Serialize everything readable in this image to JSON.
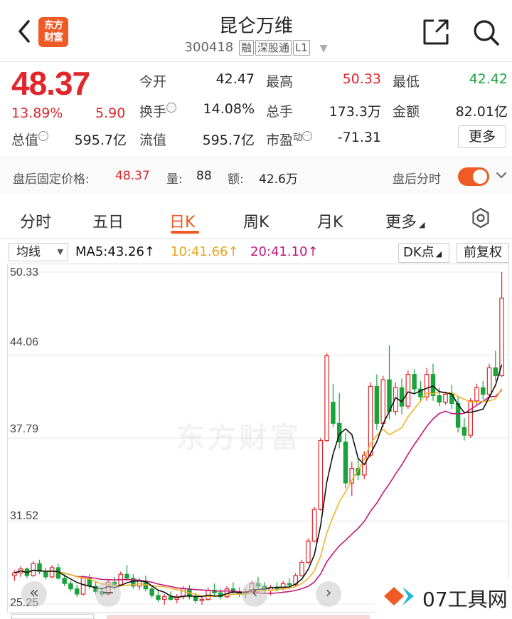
{
  "header": {
    "logo_text_1": "东方",
    "logo_text_2": "财富",
    "stock_name": "昆仑万维",
    "stock_code": "300418",
    "tags": [
      "融",
      "深股通",
      "L1"
    ]
  },
  "quote": {
    "price": "48.37",
    "change_pct": "13.89%",
    "change": "5.90",
    "fields": {
      "open_label": "今开",
      "open": "42.47",
      "high_label": "最高",
      "high": "50.33",
      "low_label": "最低",
      "low": "42.42",
      "turnover_label": "换手",
      "turnover": "14.08%",
      "volume_label": "总手",
      "volume": "173.3万",
      "amount_label": "金额",
      "amount": "82.01亿",
      "mktcap_label": "总值",
      "mktcap": "595.7亿",
      "float_label": "流值",
      "float": "595.7亿",
      "pe_label": "市盈",
      "pe_sup": "动",
      "pe": "-71.31"
    },
    "more_label": "更多"
  },
  "after_hours": {
    "price_label": "盘后固定价格:",
    "price": "48.37",
    "vol_label": "量:",
    "vol": "88",
    "amt_label": "额:",
    "amt": "42.6万",
    "intraday_label": "盘后分时"
  },
  "tabs": [
    "分时",
    "五日",
    "日K",
    "周K",
    "月K",
    "更多"
  ],
  "active_tab": "日K",
  "indicators": {
    "avg_label": "均线",
    "ma5": "MA5:43.26",
    "ma10": "10:41.66",
    "ma20": "20:41.10",
    "dk_label": "DK点",
    "adjust_label": "前复权"
  },
  "colors": {
    "up": "#e0262b",
    "down": "#1aa33a",
    "accent": "#f05a24",
    "ma5": "#111111",
    "ma10": "#f0b429",
    "ma20": "#c2187a"
  },
  "chart_data": {
    "type": "candlestick",
    "yticks": [
      "50.33",
      "44.06",
      "37.79",
      "31.52",
      "25.25"
    ],
    "ylim": [
      25.25,
      50.33
    ],
    "candles": [
      [
        27.4,
        27.8,
        27.0,
        27.6
      ],
      [
        27.6,
        28.1,
        27.3,
        27.9
      ],
      [
        27.9,
        28.0,
        27.2,
        27.4
      ],
      [
        27.4,
        28.5,
        27.3,
        28.3
      ],
      [
        28.3,
        28.6,
        27.5,
        27.7
      ],
      [
        27.7,
        28.0,
        27.1,
        27.3
      ],
      [
        27.3,
        28.2,
        27.2,
        28.0
      ],
      [
        28.0,
        28.3,
        27.1,
        27.2
      ],
      [
        27.2,
        27.5,
        26.6,
        26.8
      ],
      [
        26.8,
        27.0,
        26.2,
        26.4
      ],
      [
        26.4,
        26.7,
        25.8,
        26.0
      ],
      [
        26.0,
        27.4,
        25.9,
        27.2
      ],
      [
        27.2,
        27.5,
        26.4,
        26.6
      ],
      [
        26.6,
        26.9,
        26.0,
        26.2
      ],
      [
        26.2,
        26.5,
        25.8,
        26.0
      ],
      [
        26.0,
        27.1,
        25.9,
        26.9
      ],
      [
        26.9,
        27.3,
        26.5,
        26.7
      ],
      [
        26.7,
        27.7,
        26.6,
        27.5
      ],
      [
        27.5,
        28.2,
        27.0,
        27.2
      ],
      [
        27.2,
        27.5,
        26.4,
        26.6
      ],
      [
        26.6,
        27.2,
        26.3,
        27.0
      ],
      [
        27.0,
        27.4,
        26.2,
        26.4
      ],
      [
        26.4,
        26.7,
        25.7,
        25.9
      ],
      [
        25.9,
        26.3,
        25.4,
        25.6
      ],
      [
        25.6,
        26.0,
        25.2,
        25.8
      ],
      [
        25.8,
        26.2,
        25.5,
        25.6
      ],
      [
        25.6,
        26.0,
        25.3,
        25.8
      ],
      [
        25.8,
        26.6,
        25.6,
        26.4
      ],
      [
        26.4,
        26.7,
        25.6,
        25.8
      ],
      [
        25.8,
        26.1,
        25.3,
        25.5
      ],
      [
        25.5,
        25.8,
        25.2,
        25.6
      ],
      [
        25.6,
        26.5,
        25.5,
        26.3
      ],
      [
        26.3,
        26.8,
        25.9,
        26.1
      ],
      [
        26.1,
        26.4,
        25.6,
        25.8
      ],
      [
        25.8,
        26.6,
        25.7,
        26.4
      ],
      [
        26.4,
        26.9,
        26.0,
        26.2
      ],
      [
        26.2,
        26.5,
        25.8,
        26.0
      ],
      [
        26.0,
        26.4,
        25.7,
        26.2
      ],
      [
        26.2,
        27.0,
        26.1,
        26.8
      ],
      [
        26.8,
        27.3,
        26.4,
        26.6
      ],
      [
        26.6,
        26.9,
        26.1,
        26.3
      ],
      [
        26.3,
        26.7,
        25.9,
        26.5
      ],
      [
        26.5,
        26.9,
        26.2,
        26.4
      ],
      [
        26.4,
        27.0,
        26.3,
        26.8
      ],
      [
        26.8,
        27.2,
        26.5,
        26.7
      ],
      [
        26.7,
        27.6,
        26.6,
        27.4
      ],
      [
        27.4,
        28.6,
        27.3,
        28.4
      ],
      [
        28.4,
        30.2,
        28.3,
        30.0
      ],
      [
        30.0,
        32.6,
        29.9,
        32.4
      ],
      [
        32.4,
        37.8,
        32.3,
        37.6
      ],
      [
        37.6,
        44.2,
        37.5,
        44.0
      ],
      [
        40.5,
        41.9,
        38.6,
        38.9
      ],
      [
        38.9,
        41.2,
        37.0,
        37.5
      ],
      [
        37.5,
        38.2,
        34.0,
        34.4
      ],
      [
        34.4,
        36.0,
        33.4,
        35.5
      ],
      [
        35.5,
        36.3,
        34.6,
        35.0
      ],
      [
        35.0,
        36.8,
        34.7,
        36.5
      ],
      [
        36.5,
        42.0,
        36.3,
        41.7
      ],
      [
        41.7,
        42.6,
        38.4,
        38.9
      ],
      [
        38.9,
        42.5,
        38.6,
        42.2
      ],
      [
        42.2,
        44.8,
        39.2,
        39.8
      ],
      [
        39.8,
        42.0,
        39.5,
        41.6
      ],
      [
        41.6,
        42.3,
        39.6,
        40.2
      ],
      [
        40.2,
        42.9,
        40.0,
        42.6
      ],
      [
        42.6,
        43.0,
        41.1,
        41.5
      ],
      [
        41.5,
        42.1,
        40.5,
        40.9
      ],
      [
        40.9,
        43.1,
        40.6,
        42.6
      ],
      [
        42.6,
        43.4,
        40.6,
        41.0
      ],
      [
        41.0,
        41.6,
        40.2,
        40.5
      ],
      [
        40.5,
        41.3,
        40.3,
        41.1
      ],
      [
        41.1,
        41.8,
        40.0,
        40.4
      ],
      [
        40.4,
        40.9,
        38.2,
        38.6
      ],
      [
        38.6,
        39.3,
        37.6,
        38.0
      ],
      [
        38.0,
        40.8,
        37.8,
        40.6
      ],
      [
        40.6,
        41.9,
        40.3,
        41.6
      ],
      [
        41.6,
        42.1,
        40.7,
        41.1
      ],
      [
        41.1,
        43.4,
        40.9,
        43.1
      ],
      [
        43.1,
        44.4,
        42.1,
        42.5
      ],
      [
        42.5,
        50.33,
        42.42,
        48.37
      ]
    ]
  }
}
